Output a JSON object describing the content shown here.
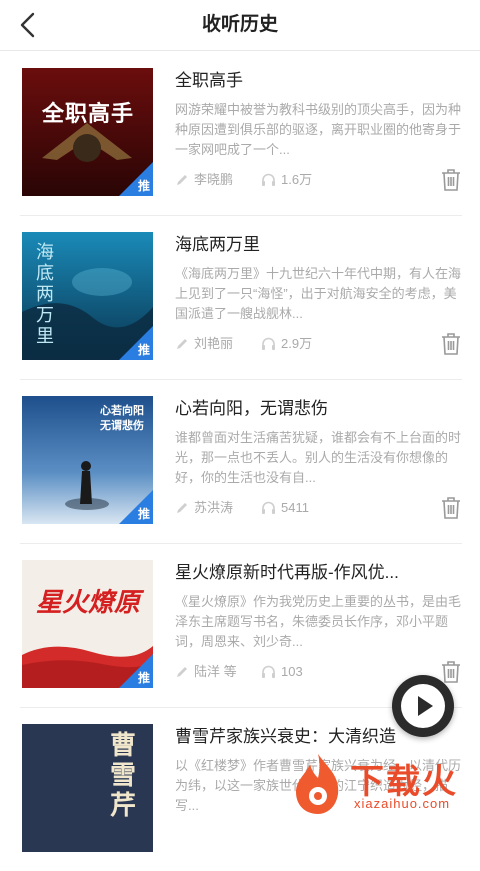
{
  "header": {
    "title": "收听历史"
  },
  "items": [
    {
      "title": "全职高手",
      "cover_text": "全职高手",
      "desc": "网游荣耀中被誉为教科书级别的顶尖高手，因为种种原因遭到俱乐部的驱逐，离开职业圈的他寄身于一家网吧成了一个...",
      "author": "李晓鹏",
      "plays": "1.6万",
      "badge": "推"
    },
    {
      "title": "海底两万里",
      "cover_text": "海底两万里",
      "desc": "《海底两万里》十九世纪六十年代中期，有人在海上见到了一只“海怪”，出于对航海安全的考虑，美国派遣了一艘战舰林...",
      "author": "刘艳丽",
      "plays": "2.9万",
      "badge": "推"
    },
    {
      "title": "心若向阳，无谓悲伤",
      "cover_text": "心若向阳 无谓悲伤",
      "desc": "谁都曾面对生活痛苦犹疑，谁都会有不上台面的时光，那一点也不丢人。别人的生活没有你想像的好，你的生活也没有自...",
      "author": "苏洪涛",
      "plays": "5411",
      "badge": "推"
    },
    {
      "title": "星火燎原新时代再版-作风优...",
      "cover_text": "星火燎原",
      "desc": "《星火燎原》作为我党历史上重要的丛书，是由毛泽东主席题写书名，朱德委员长作序，邓小平题词，周恩来、刘少奇...",
      "author": "陆洋 等",
      "plays": "103",
      "badge": "推"
    },
    {
      "title": "曹雪芹家族兴衰史：大清织造",
      "cover_text": "曹雪芹",
      "desc": "以《红楼梦》作者曹雪芹家族兴衰为经，以清代历为纬，以这一家族世代担任的江宁织造为经，描写...",
      "author": "",
      "plays": "",
      "badge": ""
    }
  ],
  "watermark": {
    "text": "下载火",
    "sub": "xiazaihuo.com"
  },
  "colors": {
    "accent": "#2a7de1",
    "brand": "#e94c2b"
  }
}
